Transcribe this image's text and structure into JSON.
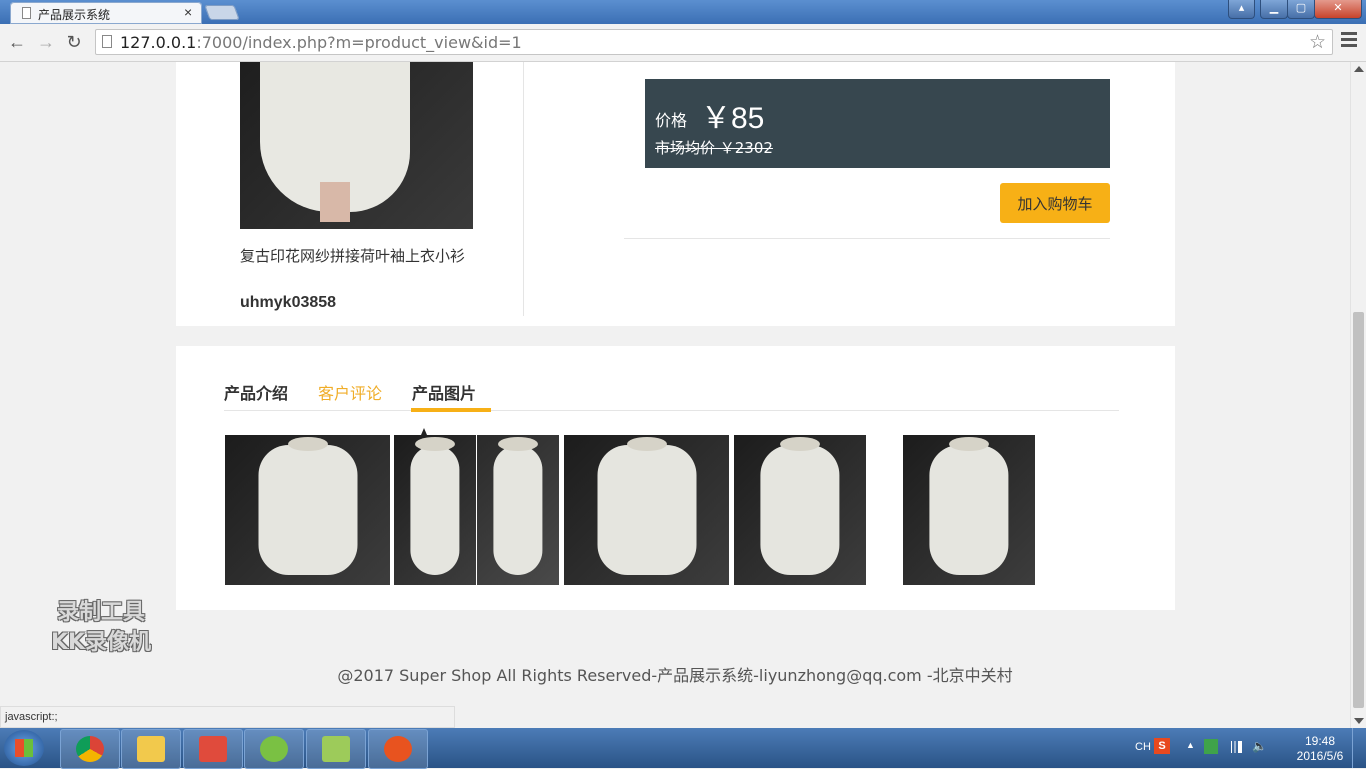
{
  "browser": {
    "tab_title": "产品展示系统",
    "tab_close": "×",
    "url_host": "127.0.0.1",
    "url_rest": ":7000/index.php?m=product_view&id=1",
    "win_controls": {
      "user": "▴",
      "minimize": "▁",
      "maximize": "▢",
      "close": "✕"
    }
  },
  "product": {
    "name": "复古印花网纱拼接荷叶袖上衣小衫",
    "sku": "uhmyk03858",
    "price_label": "价格",
    "price_value": "￥85",
    "market_price": "市场均价 ￥2302",
    "add_to_cart": "加入购物车"
  },
  "tabs": [
    {
      "label": "产品介绍"
    },
    {
      "label": "客户评论"
    },
    {
      "label": "产品图片"
    }
  ],
  "gallery": {
    "count": 6
  },
  "footer": {
    "text": "@2017 Super Shop All Rights Reserved-产品展示系统-liyunzhong@qq.com -北京中关村"
  },
  "status_bar": "javascript:;",
  "watermark": {
    "line1": "录制工具",
    "line2": "KK录像机"
  },
  "taskbar": {
    "lang": "CH",
    "ime": "S",
    "time": "19:48",
    "date": "2016/5/6"
  },
  "colors": {
    "accent": "#f7b016",
    "price_box": "#37474f",
    "tab_hover": "#f0ad28"
  }
}
